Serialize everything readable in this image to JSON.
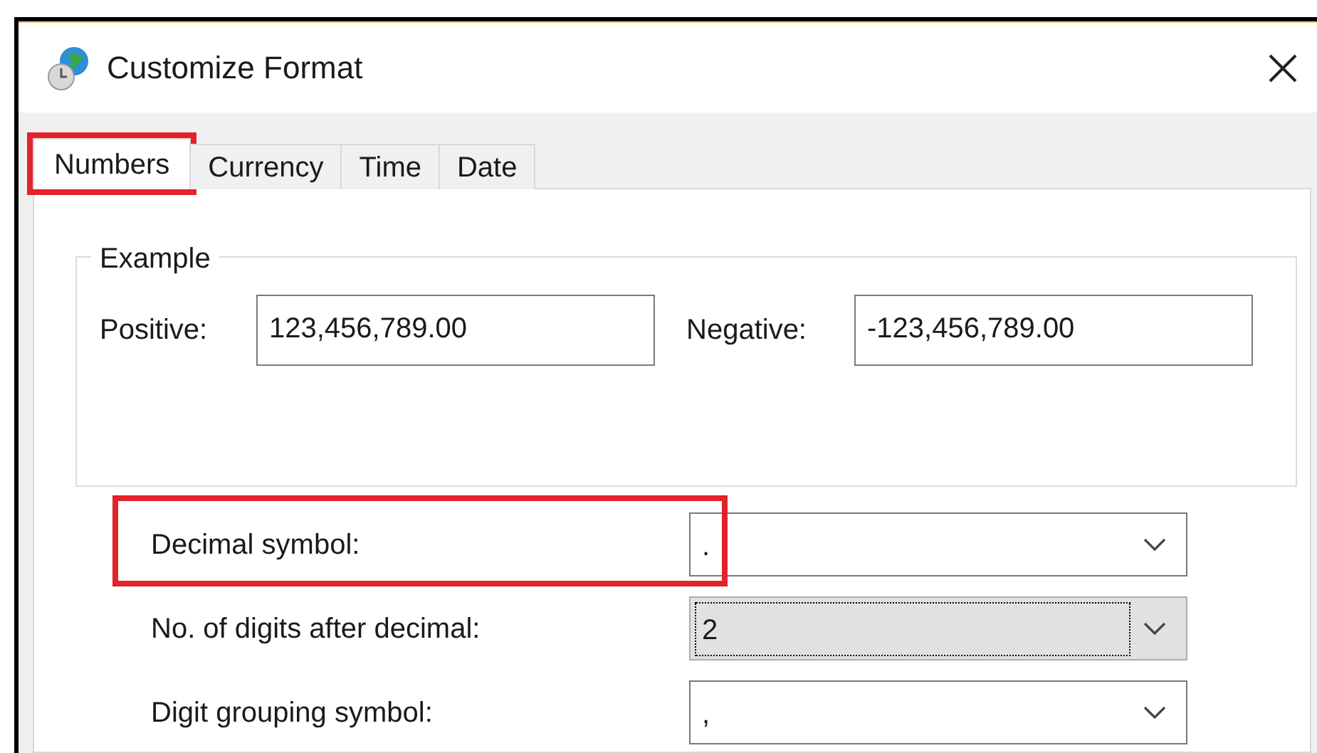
{
  "window": {
    "title": "Customize Format"
  },
  "tabs": [
    {
      "label": "Numbers",
      "selected": true,
      "highlighted": true
    },
    {
      "label": "Currency",
      "selected": false,
      "highlighted": false
    },
    {
      "label": "Time",
      "selected": false,
      "highlighted": false
    },
    {
      "label": "Date",
      "selected": false,
      "highlighted": false
    }
  ],
  "example": {
    "title": "Example",
    "positive_label": "Positive:",
    "positive_value": "123,456,789.00",
    "negative_label": "Negative:",
    "negative_value": "-123,456,789.00"
  },
  "settings": [
    {
      "label": "Decimal symbol:",
      "value": ".",
      "focused": false,
      "highlighted": true
    },
    {
      "label": "No. of digits after decimal:",
      "value": "2",
      "focused": true,
      "highlighted": false
    },
    {
      "label": "Digit grouping symbol:",
      "value": ",",
      "focused": false,
      "highlighted": false
    }
  ]
}
